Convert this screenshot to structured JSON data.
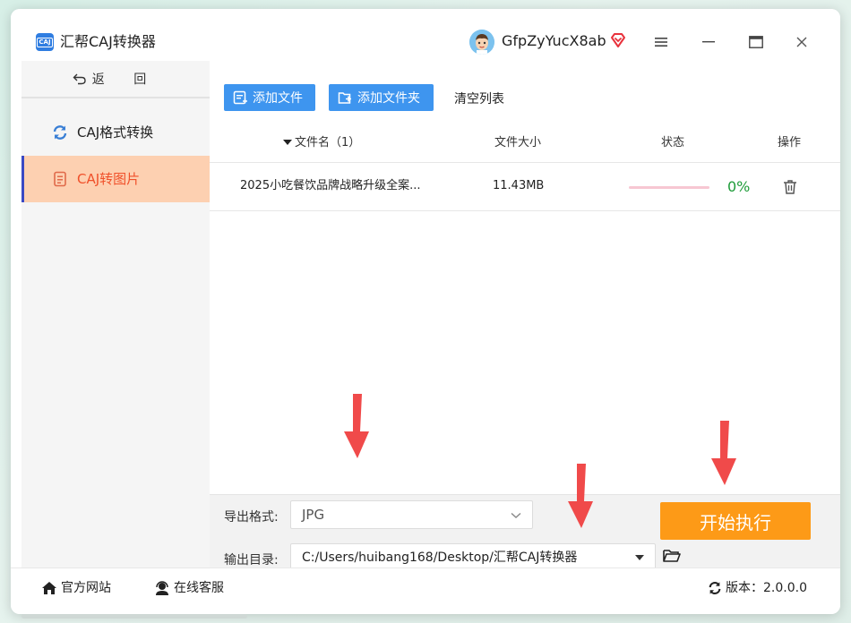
{
  "app": {
    "title": "汇帮CAJ转换器",
    "logo_text": "CAJ",
    "username": "GfpZyYucX8ab"
  },
  "window_controls": {
    "menu_icon": "hamburger-icon",
    "minimize_icon": "minimize-icon",
    "maximize_icon": "maximize-icon",
    "close_icon": "close-icon"
  },
  "sidebar": {
    "back_label": "返 回",
    "items": [
      {
        "label": "CAJ格式转换",
        "icon": "refresh-icon",
        "active": false
      },
      {
        "label": "CAJ转图片",
        "icon": "document-icon",
        "active": true
      }
    ]
  },
  "toolbar": {
    "add_file_label": "添加文件",
    "add_folder_label": "添加文件夹",
    "clear_list_label": "清空列表"
  },
  "table": {
    "headers": {
      "filename": "文件名（1）",
      "size": "文件大小",
      "status": "状态",
      "action": "操作"
    },
    "rows": [
      {
        "filename": "2025小吃餐饮品牌战略升级全案...",
        "size": "11.43MB",
        "progress": 0,
        "progress_label": "0%"
      }
    ]
  },
  "options": {
    "format_label": "导出格式:",
    "format_value": "JPG",
    "dir_label": "输出目录:",
    "dir_value": "C:/Users/huibang168/Desktop/汇帮CAJ转换器",
    "start_label": "开始执行"
  },
  "footer": {
    "website_label": "官方网站",
    "support_label": "在线客服",
    "version_label": "版本：2.0.0.0"
  },
  "colors": {
    "primary_blue": "#3e95ef",
    "active_nav_bg": "#fdd0b1",
    "active_nav_text": "#f0502a",
    "start_button": "#fd9a17",
    "progress_text": "#1f9c3a",
    "annotation_arrow": "#f04a4a"
  }
}
